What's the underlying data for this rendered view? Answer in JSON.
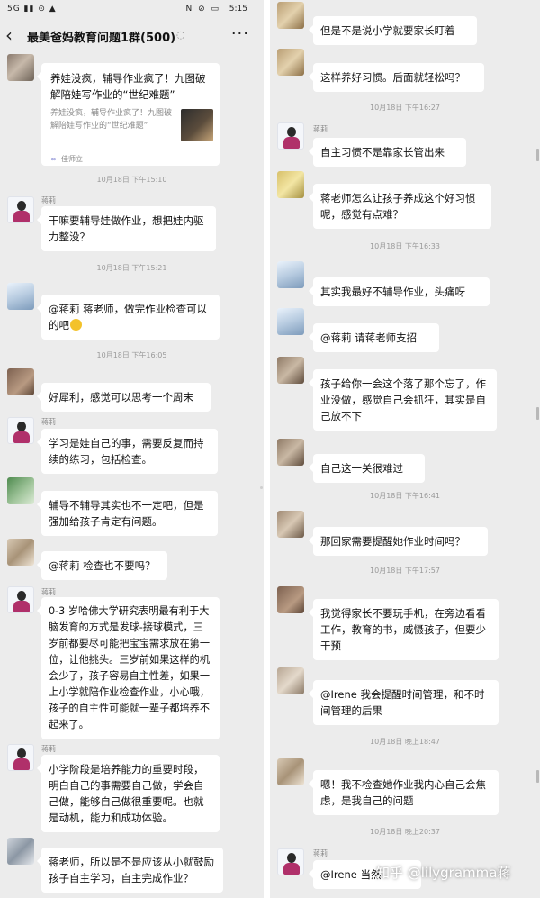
{
  "status_bar": {
    "left_indicators": "5G ▮▮ ⊙ ▲",
    "right_icons": "N ⊘ ▭",
    "time": "5:15"
  },
  "header": {
    "back_icon": "chevron-left-icon",
    "title": "最美爸妈教育问题1群(500)",
    "mute_icon": "bell-off-icon",
    "more_icon": "more-icon"
  },
  "left_messages": {
    "link_card": {
      "title": "养娃没疯，辅导作业疯了！九图破解陪娃写作业的“世纪难题”",
      "description": "养娃没疯，辅导作业疯了！九图破解陪娃写作业的“世纪难题”",
      "source": "佳师立"
    },
    "time_1": "10月18日 下午15:10",
    "sender_1": "蒋莉",
    "msg_1": "干嘛要辅导娃做作业，想把娃内驱力整没？",
    "time_2": "10月18日 下午15:21",
    "msg_2": "@蒋莉  蒋老师，做完作业检查可以的吧",
    "time_3": "10月18日 下午16:05",
    "msg_3": "好犀利，感觉可以思考一个周末",
    "sender_4": "蒋莉",
    "msg_4": "学习是娃自己的事，需要反复而持续的练习，包括检查。",
    "msg_5": "辅导不辅导其实也不一定吧，但是强加给孩子肯定有问题。",
    "msg_6": "@蒋莉  检查也不要吗？",
    "sender_7": "蒋莉",
    "msg_7": "0-3 岁哈佛大学研究表明最有利于大脑发育的方式是发球-接球模式，三岁前都要尽可能把宝宝需求放在第一位，让他挑头。三岁前如果这样的机会少了，孩子容易自主性差，如果一上小学就陪作业检查作业，小心哦，孩子的自主性可能就一辈子都培养不起来了。",
    "sender_8": "蒋莉",
    "msg_8": "小学阶段是培养能力的重要时段，明白自己的事需要自己做，学会自己做，能够自己做很重要呢。也就是动机，能力和成功体验。",
    "msg_9": "蒋老师，所以是不是应该从小就鼓励孩子自主学习，自主完成作业？"
  },
  "right_messages": {
    "msg_1": "但是不是说小学就要家长盯着",
    "msg_2": "这样养好习惯。后面就轻松吗？",
    "time_1": "10月18日 下午16:27",
    "sender_3": "蒋莉",
    "msg_3": "自主习惯不是靠家长管出来",
    "msg_4": "蒋老师怎么让孩子养成这个好习惯呢，感觉有点难？",
    "time_2": "10月18日 下午16:33",
    "msg_5": "其实我最好不辅导作业，头痛呀",
    "msg_6": "@蒋莉  请蒋老师支招",
    "msg_7": "孩子给你一会这个落了那个忘了，作业没做，感觉自己会抓狂，其实是自己放不下",
    "msg_8": "自己这一关很难过",
    "time_3": "10月18日 下午16:41",
    "msg_9": "那回家需要提醒她作业时间吗？",
    "time_4": "10月18日 下午17:57",
    "msg_10": "我觉得家长不要玩手机，在旁边看看工作，教育的书，威慑孩子，但要少干预",
    "msg_11": "@Irene  我会提醒时间管理，和不时间管理的后果",
    "time_5": "10月18日 晚上18:47",
    "msg_12": "嗯！我不检查她作业我内心自己会焦虑，是我自己的问题",
    "time_6": "10月18日 晚上20:37",
    "sender_13": "蒋莉",
    "msg_13": "@Irene  当然"
  },
  "watermark": "知乎 @lilygramma蒋",
  "colors": {
    "chat_background": "#ececec",
    "bubble": "#ffffff",
    "timestamp": "#9a9a9a"
  }
}
